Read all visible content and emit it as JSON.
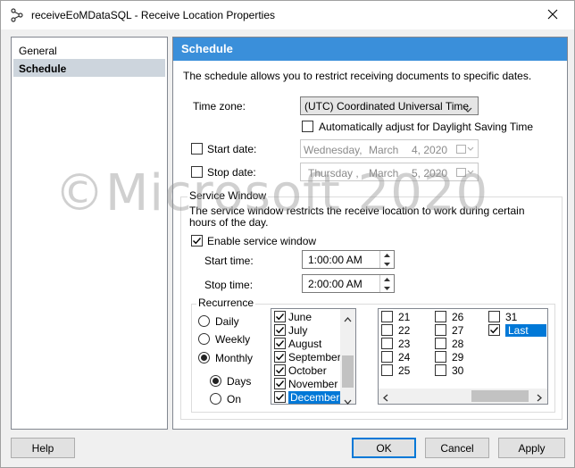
{
  "window": {
    "title": "receiveEoMDataSQL - Receive Location Properties",
    "app_icon": "receive-location-icon",
    "close_icon": "close-icon"
  },
  "nav": {
    "items": [
      {
        "label": "General",
        "selected": false
      },
      {
        "label": "Schedule",
        "selected": true
      }
    ]
  },
  "schedule": {
    "header": "Schedule",
    "description": "The schedule allows you to restrict receiving documents to specific dates.",
    "time_zone_label": "Time zone:",
    "time_zone_value": "(UTC) Coordinated Universal Time",
    "dst_label": "Automatically adjust for Daylight Saving Time",
    "dst_checked": false,
    "start_date_label": "Start date:",
    "start_date_checked": false,
    "start_date_value": {
      "weekday": "Wednesday,",
      "month": "March",
      "day": "4, 2020"
    },
    "stop_date_label": "Stop date:",
    "stop_date_checked": false,
    "stop_date_value": {
      "weekday": "Thursday ,",
      "month": "March",
      "day": "5, 2020"
    }
  },
  "service_window": {
    "title": "Service Window",
    "description": "The service window restricts the receive location to work during certain hours of the day.",
    "enable_label": "Enable service window",
    "enable_checked": true,
    "start_time_label": "Start time:",
    "start_time_value": "1:00:00 AM",
    "stop_time_label": "Stop time:",
    "stop_time_value": "2:00:00 AM"
  },
  "recurrence": {
    "title": "Recurrence",
    "options": [
      {
        "label": "Daily",
        "selected": false
      },
      {
        "label": "Weekly",
        "selected": false
      },
      {
        "label": "Monthly",
        "selected": true
      }
    ],
    "monthly_mode": [
      {
        "label": "Days",
        "selected": true
      },
      {
        "label": "On",
        "selected": false
      }
    ],
    "months": [
      {
        "label": "June",
        "checked": true,
        "selected": false
      },
      {
        "label": "July",
        "checked": true,
        "selected": false
      },
      {
        "label": "August",
        "checked": true,
        "selected": false
      },
      {
        "label": "September",
        "checked": true,
        "selected": false
      },
      {
        "label": "October",
        "checked": true,
        "selected": false
      },
      {
        "label": "November",
        "checked": true,
        "selected": false
      },
      {
        "label": "December",
        "checked": true,
        "selected": true
      }
    ],
    "days": [
      {
        "label": "21",
        "checked": false,
        "selected": false
      },
      {
        "label": "22",
        "checked": false,
        "selected": false
      },
      {
        "label": "23",
        "checked": false,
        "selected": false
      },
      {
        "label": "24",
        "checked": false,
        "selected": false
      },
      {
        "label": "25",
        "checked": false,
        "selected": false
      },
      {
        "label": "26",
        "checked": false,
        "selected": false
      },
      {
        "label": "27",
        "checked": false,
        "selected": false
      },
      {
        "label": "28",
        "checked": false,
        "selected": false
      },
      {
        "label": "29",
        "checked": false,
        "selected": false
      },
      {
        "label": "30",
        "checked": false,
        "selected": false
      },
      {
        "label": "31",
        "checked": false,
        "selected": false
      },
      {
        "label": "Last",
        "checked": true,
        "selected": true
      }
    ]
  },
  "watermark": "©Microsoft 2020",
  "buttons": {
    "help": "Help",
    "ok": "OK",
    "cancel": "Cancel",
    "apply": "Apply"
  },
  "colors": {
    "header_bg": "#3a8fda",
    "selection": "#0078d7",
    "nav_selected": "#cdd5dd"
  }
}
